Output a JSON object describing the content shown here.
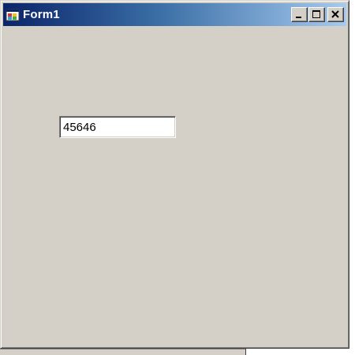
{
  "window": {
    "title": "Form1",
    "icon": "form-app-icon",
    "buttons": {
      "minimize_icon": "minimize-icon",
      "maximize_icon": "maximize-icon",
      "close_icon": "close-icon"
    }
  },
  "form": {
    "textbox_value": "45646"
  },
  "colors": {
    "titlebar_start": "#0a246a",
    "titlebar_end": "#a6caf0",
    "window_bg": "#d4d0c8",
    "textbox_bg": "#ffffff"
  }
}
